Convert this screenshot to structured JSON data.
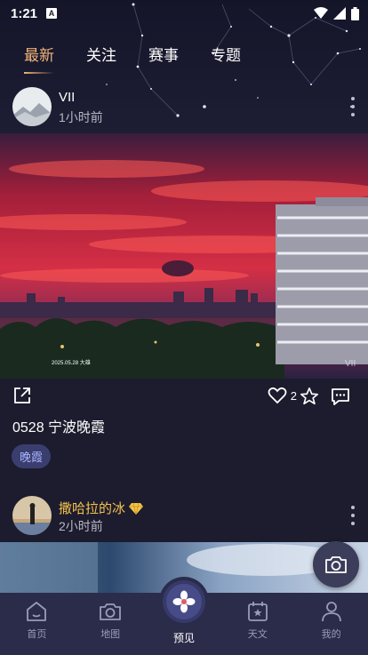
{
  "status": {
    "time": "1:21",
    "a_badge": "A"
  },
  "tabs": [
    {
      "label": "最新",
      "active": true
    },
    {
      "label": "关注",
      "active": false
    },
    {
      "label": "赛事",
      "active": false
    },
    {
      "label": "专题",
      "active": false
    }
  ],
  "post1": {
    "username": "VII",
    "time": "1小时前",
    "like_count": "2",
    "title": "0528 宁波晚霞",
    "tag": "晚霞",
    "photo_caption": "2025.05.28 大雄",
    "watermark": "VII"
  },
  "post2": {
    "username": "撒哈拉的冰",
    "badge_icon": "gold-diamond-icon",
    "time": "2小时前"
  },
  "nav": [
    {
      "label": "首页",
      "icon": "home-icon"
    },
    {
      "label": "地图",
      "icon": "camera-icon"
    },
    {
      "label": "预见",
      "icon": "flower-icon"
    },
    {
      "label": "天文",
      "icon": "calendar-star-icon"
    },
    {
      "label": "我的",
      "icon": "user-icon"
    }
  ],
  "colors": {
    "accent": "#f0b477",
    "background": "#1c1c2e",
    "nav_bg": "#2b2c4a",
    "tag_bg": "#3a3e6e"
  }
}
